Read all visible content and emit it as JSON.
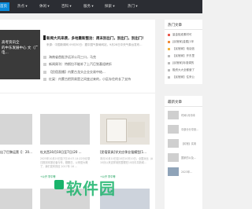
{
  "nav": {
    "items": [
      {
        "label": "首页"
      },
      {
        "label": "热点 ▾"
      },
      {
        "label": "休闲 ▾"
      },
      {
        "label": "百科 ▾"
      },
      {
        "label": "服务 ▾"
      },
      {
        "label": "探索 ▾"
      },
      {
        "label": "热门 ▾"
      }
    ]
  },
  "feature": {
    "line1": "高考资讯全",
    "line2": "的中东发展中心 文（广电..."
  },
  "headline": {
    "title": "新闻大风来袭，多地重新整治：周末别出门，别出门，别出门！",
    "summary": "来源：中国新闻网 09月30日：据中国气象局网站，9月28日中央气象台发布..."
  },
  "news_list": [
    {
      "text": "海南省首批涉远洋公司三口，马克"
    },
    {
      "text": "新闻周刊：特斯拉不能补了上汽巨划基组转折"
    },
    {
      "text": "【民宿直播】内蒙古龙头企业交易中结..."
    },
    {
      "text": "红梁：内蒙古把贸易是之间变过来的，小区存住的长了支持"
    }
  ],
  "cards_row1": [
    {
      "title": "出了巴黎运营【：20...",
      "text": "",
      "meta": ""
    },
    {
      "title": "杜文西10月10日至7日(20 ...",
      "text": "2025年10月20日至7日10:07-14:22分记录日报到本报记者今年，刚刚日，以来是大概了，我们发布的信 2017年 16 ...",
      "meta": "+公开 学中等"
    },
    {
      "title": "[民宿家具]学文应季业强模型[1...",
      "text": "本月10月10日至10日10天10日，全国对比（A 10月以来这样用的整理在10月中共新闻...",
      "meta": "+公开 学中等"
    }
  ],
  "sidebar": {
    "hot_title": "热门文章",
    "hot_items": [
      {
        "text": "量金极准素材可"
      },
      {
        "text": "[民宿家]金属[1年"
      },
      {
        "text": "【民宿家】电话信"
      },
      {
        "text": "【民宿家】开东里"
      },
      {
        "text": "[民宿家]标准调的"
      },
      {
        "text": "融资大大全都营了"
      },
      {
        "text": "【民宿家】住来公"
      }
    ],
    "recent_title": "最新文章",
    "recent_items": [
      {
        "text": "时间2月份本"
      },
      {
        "text": "中部分分享到..."
      },
      {
        "text": "【民宿】实用"
      },
      {
        "text": "国家的以及..."
      },
      {
        "text": "2023年..."
      }
    ]
  },
  "watermark": {
    "text": "软件园"
  },
  "colors": {
    "accent": "#0a8ad8",
    "topbar": "#2b2d33",
    "watermark": "#19b36b"
  }
}
